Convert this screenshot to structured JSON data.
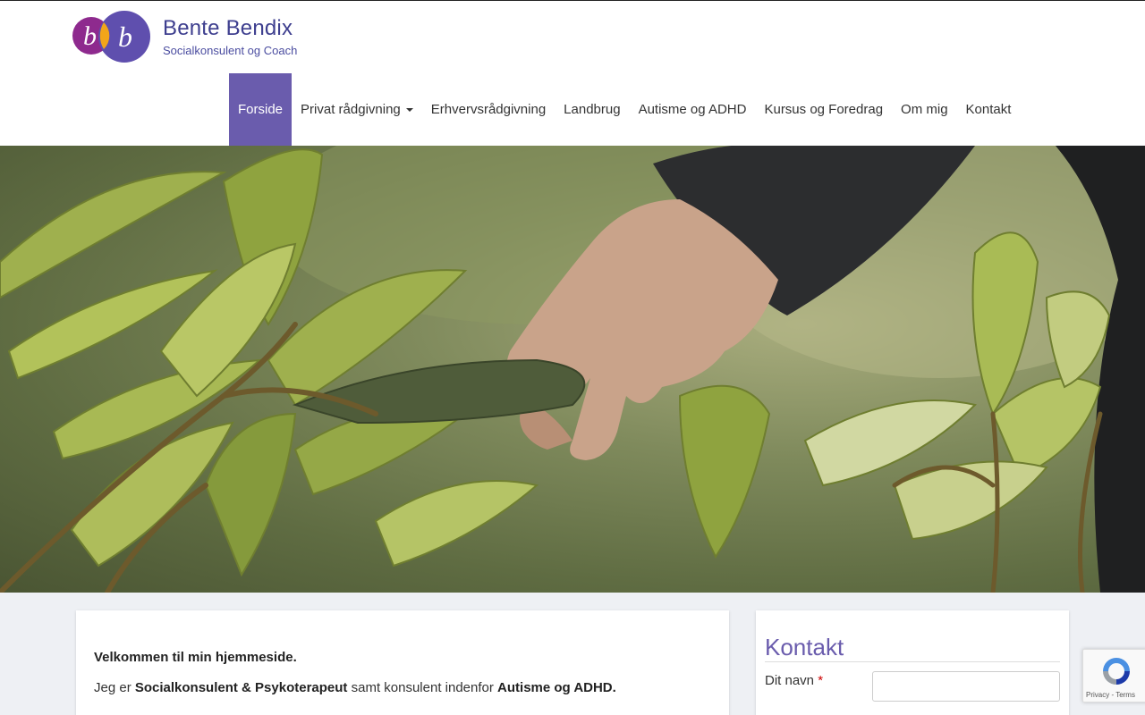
{
  "logo": {
    "name": "Bente Bendix",
    "subtitle": "Socialkonsulent og Coach",
    "initials": [
      "b",
      "b"
    ],
    "colors": {
      "left_circle": "#8e2a8e",
      "right_circle": "#5f4fae",
      "overlap": "#f2a51a"
    }
  },
  "nav": {
    "items": [
      {
        "label": "Forside",
        "active": true
      },
      {
        "label": "Privat rådgivning",
        "dropdown": true
      },
      {
        "label": "Erhvervsrådgivning"
      },
      {
        "label": "Landbrug"
      },
      {
        "label": "Autisme og ADHD"
      },
      {
        "label": "Kursus og Foredrag"
      },
      {
        "label": "Om mig"
      },
      {
        "label": "Kontakt"
      }
    ],
    "active_color": "#6a5cad"
  },
  "main": {
    "welcome": "Velkommen til min hjemmeside.",
    "intro": {
      "prefix": "Jeg er ",
      "role": "Socialkonsulent & Psykoterapeut",
      "middle": " samt konsulent indenfor ",
      "field": "Autisme og ADHD."
    }
  },
  "sidebar": {
    "title": "Kontakt",
    "name_label": "Dit navn",
    "required_mark": "*",
    "name_value": ""
  },
  "recaptcha": {
    "links": "Privacy - Terms"
  },
  "icons": [
    "recaptcha-icon",
    "caret-down-icon"
  ]
}
